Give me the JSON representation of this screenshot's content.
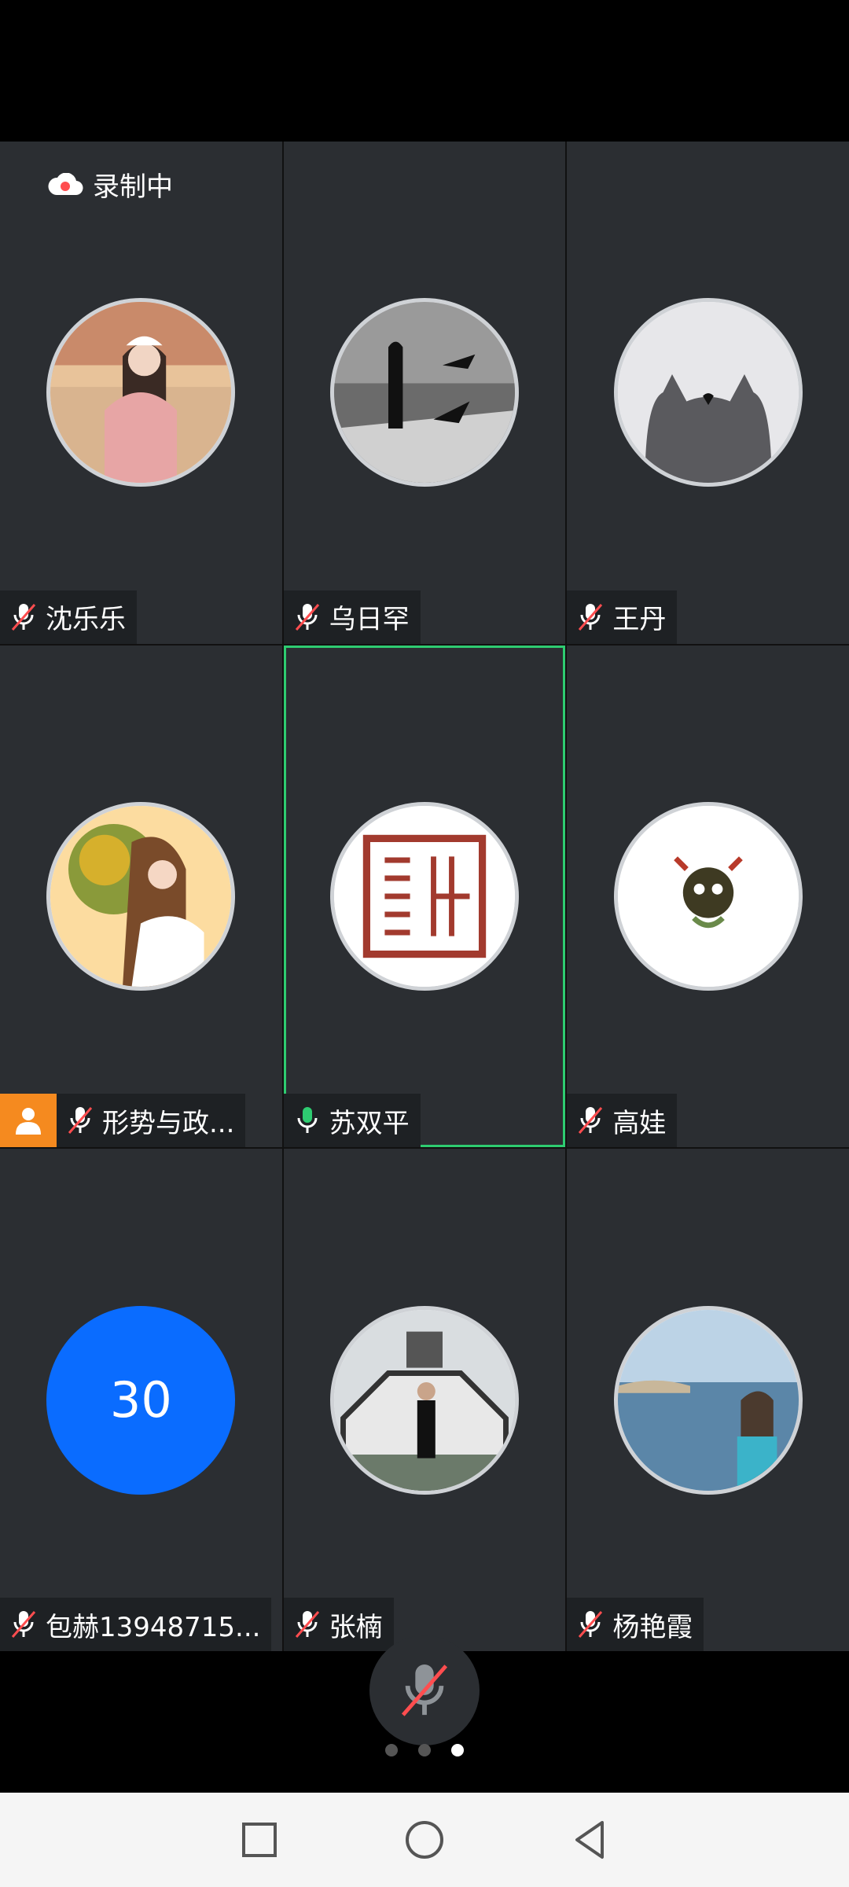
{
  "recording": {
    "label": "录制中"
  },
  "participants": [
    {
      "name": "沈乐乐",
      "muted": true
    },
    {
      "name": "乌日罕",
      "muted": true
    },
    {
      "name": "王丹",
      "muted": true
    },
    {
      "name": "形势与政...",
      "muted": true,
      "host": true
    },
    {
      "name": "苏双平",
      "muted": false,
      "speaking": true
    },
    {
      "name": "高娃",
      "muted": true
    },
    {
      "name": "包赫13948715...",
      "muted": true,
      "avatar_text": "30"
    },
    {
      "name": "张楠",
      "muted": true
    },
    {
      "name": "杨艳霞",
      "muted": true
    }
  ],
  "pager": {
    "pages": 3,
    "current": 3
  },
  "icons": {
    "muted_mic": "mic-muted-icon",
    "active_mic": "mic-active-icon",
    "recording": "cloud-recording-icon",
    "host": "host-person-icon"
  },
  "colors": {
    "active_border": "#2ecc71",
    "host_badge": "#f58a1f",
    "avatar_blue": "#0a6cff",
    "recording_dot": "#ff4d4f"
  }
}
